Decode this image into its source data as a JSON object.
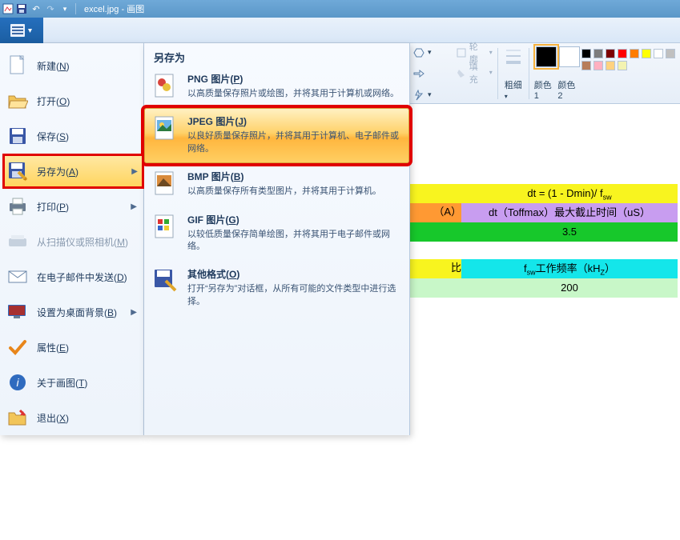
{
  "titlebar": {
    "docname": "excel.jpg",
    "sep": " - ",
    "appname": "画图"
  },
  "left_menu": {
    "items": [
      {
        "label": "新建(N)",
        "hotkey": "N"
      },
      {
        "label": "打开(O)",
        "hotkey": "O"
      },
      {
        "label": "保存(S)",
        "hotkey": "S"
      },
      {
        "label": "另存为(A)",
        "hotkey": "A",
        "selected": true,
        "has_sub": true
      },
      {
        "label": "打印(P)",
        "hotkey": "P",
        "has_sub": true
      },
      {
        "label": "从扫描仪或照相机(M)",
        "hotkey": "M",
        "disabled": true
      },
      {
        "label": "在电子邮件中发送(D)",
        "hotkey": "D"
      },
      {
        "label": "设置为桌面背景(B)",
        "hotkey": "B",
        "has_sub": true
      },
      {
        "label": "属性(E)",
        "hotkey": "E"
      },
      {
        "label": "关于画图(T)",
        "hotkey": "T"
      },
      {
        "label": "退出(X)",
        "hotkey": "X"
      }
    ]
  },
  "submenu": {
    "header": "另存为",
    "items": [
      {
        "title": "PNG 图片(P)",
        "desc": "以高质量保存照片或绘图，并将其用于计算机或网络。"
      },
      {
        "title": "JPEG 图片(J)",
        "desc": "以良好质量保存照片，并将其用于计算机、电子邮件或网络。",
        "hover": true
      },
      {
        "title": "BMP 图片(B)",
        "desc": "以高质量保存所有类型图片，并将其用于计算机。"
      },
      {
        "title": "GIF 图片(G)",
        "desc": "以较低质量保存简单绘图，并将其用于电子邮件或网络。"
      },
      {
        "title": "其他格式(O)",
        "desc": "打开“另存为”对话框，从所有可能的文件类型中进行选择。"
      }
    ]
  },
  "ribbon": {
    "outline": "轮廓",
    "fill": "填充",
    "thickness": "粗细",
    "color1": "颜色 1",
    "color2": "颜色 2",
    "palette": [
      "#000000",
      "#7d7d7d",
      "#7d0000",
      "#ff0000",
      "#ff7d00",
      "#ffff00",
      "#ffffff",
      "#c0c0c0",
      "#b77d5a",
      "#ffb0c0",
      "#ffd27f",
      "#f3f3b1"
    ]
  },
  "canvas": {
    "rows": [
      {
        "cls": "c-yellow",
        "html": "dt = (1 - Dmin)/ f<sub>sw</sub>"
      },
      {
        "cls": "c-purple",
        "html": "dt（Toffmax）最大截止时间（uS）"
      },
      {
        "cls": "c-green",
        "html": "3.5"
      },
      {
        "cls": "c-blue",
        "html": "f<sub>sw</sub>工作频率（kH<sub>Z</sub>）"
      },
      {
        "cls": "c-lgreen",
        "html": "200"
      }
    ],
    "strip_header": "（A）",
    "strip_char": "比"
  }
}
